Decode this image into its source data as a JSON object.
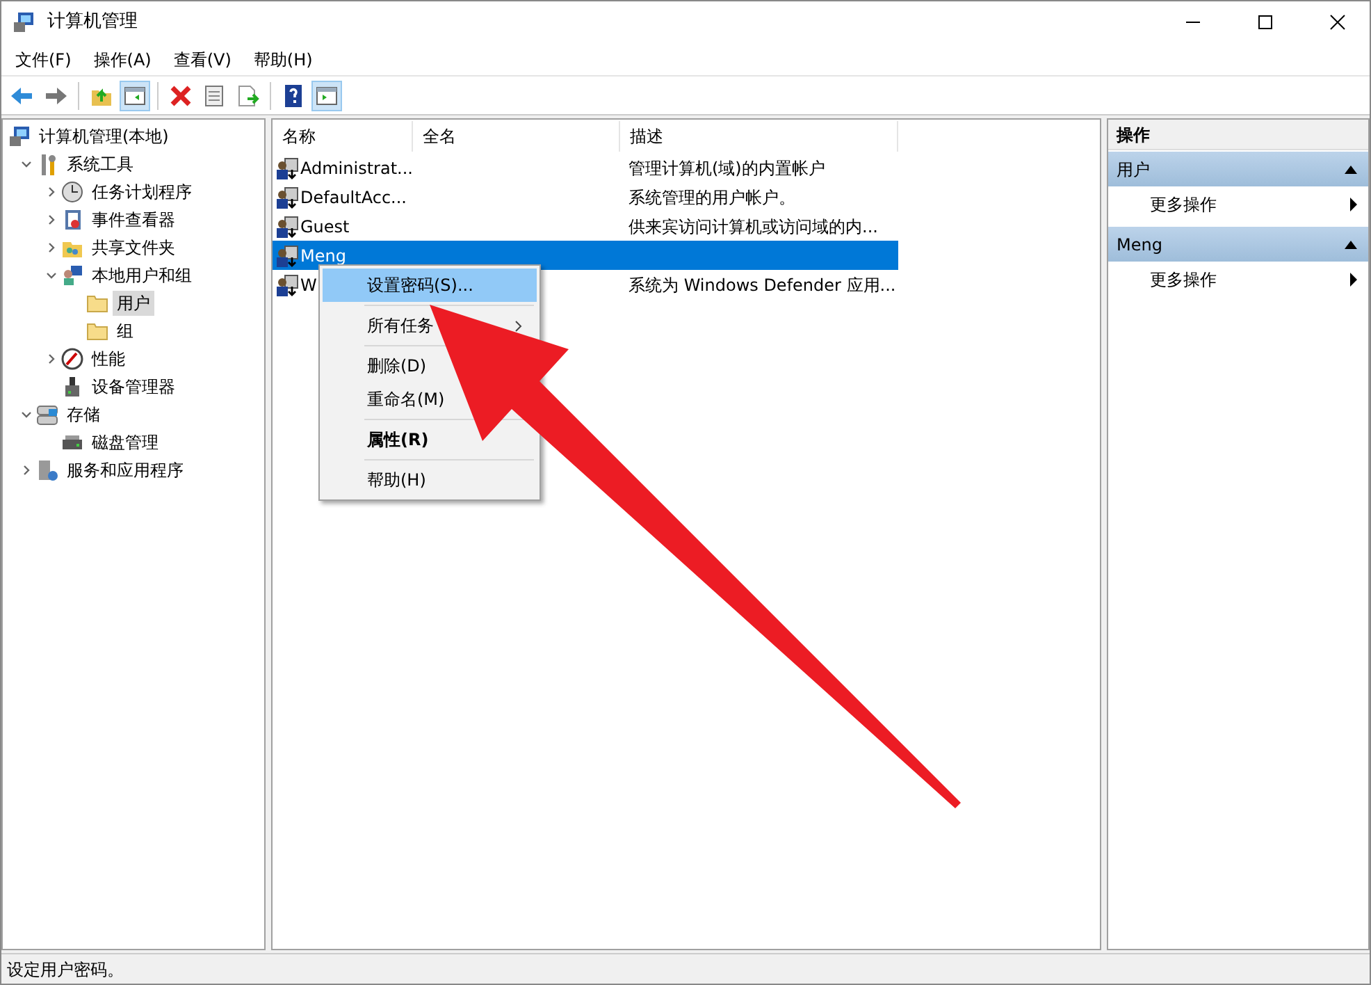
{
  "window": {
    "title": "计算机管理"
  },
  "menu": [
    "文件(F)",
    "操作(A)",
    "查看(V)",
    "帮助(H)"
  ],
  "toolbar": [
    {
      "kind": "back",
      "on": false
    },
    {
      "kind": "forward",
      "on": false
    },
    {
      "kind": "sep"
    },
    {
      "kind": "up",
      "on": false
    },
    {
      "kind": "tree",
      "on": true
    },
    {
      "kind": "sep"
    },
    {
      "kind": "delete",
      "on": false
    },
    {
      "kind": "props",
      "on": false
    },
    {
      "kind": "export",
      "on": false
    },
    {
      "kind": "sep"
    },
    {
      "kind": "help",
      "on": false
    },
    {
      "kind": "pane",
      "on": true
    }
  ],
  "tree": [
    {
      "label": "计算机管理(本地)",
      "kind": "computer",
      "selected": false,
      "children": [
        {
          "label": "系统工具",
          "kind": "tools",
          "selected": false,
          "expanded": true,
          "children": [
            {
              "label": "任务计划程序",
              "kind": "clock",
              "selected": false,
              "expanded": false
            },
            {
              "label": "事件查看器",
              "kind": "log",
              "selected": false,
              "expanded": false
            },
            {
              "label": "共享文件夹",
              "kind": "share",
              "selected": false,
              "expanded": false
            },
            {
              "label": "本地用户和组",
              "kind": "users",
              "selected": false,
              "expanded": true,
              "children": [
                {
                  "label": "用户",
                  "kind": "folder",
                  "selected": true
                },
                {
                  "label": "组",
                  "kind": "folder",
                  "selected": false
                }
              ]
            },
            {
              "label": "性能",
              "kind": "perf",
              "selected": false,
              "expanded": false
            },
            {
              "label": "设备管理器",
              "kind": "device",
              "selected": false
            }
          ]
        },
        {
          "label": "存储",
          "kind": "storage",
          "selected": false,
          "expanded": true,
          "children": [
            {
              "label": "磁盘管理",
              "kind": "disk",
              "selected": false
            }
          ]
        },
        {
          "label": "服务和应用程序",
          "kind": "services",
          "selected": false,
          "expanded": false
        }
      ]
    }
  ],
  "table": {
    "columns": [
      "名称",
      "全名",
      "描述"
    ],
    "rows": [
      {
        "name": "Administrat...",
        "description": "管理计算机(域)的内置帐户",
        "selected": false
      },
      {
        "name": "DefaultAcc...",
        "description": "系统管理的用户帐户。",
        "selected": false
      },
      {
        "name": "Guest",
        "description": "供来宾访问计算机或访问域的内...",
        "selected": false
      },
      {
        "name": "Meng",
        "selected": true
      },
      {
        "name": "W",
        "description": "系统为 Windows Defender 应用...",
        "selected": false
      }
    ]
  },
  "context_menu": [
    {
      "kind": "item",
      "label": "设置密码(S)...",
      "selected": true
    },
    {
      "kind": "separator"
    },
    {
      "kind": "item",
      "label": "所有任务",
      "selected": false,
      "submenu": true
    },
    {
      "kind": "separator"
    },
    {
      "kind": "item",
      "label": "删除(D)",
      "selected": false
    },
    {
      "kind": "item",
      "label": "重命名(M)",
      "selected": false
    },
    {
      "kind": "separator"
    },
    {
      "kind": "item",
      "label": "属性(R)",
      "selected": false,
      "bold": true
    },
    {
      "kind": "separator"
    },
    {
      "kind": "item",
      "label": "帮助(H)",
      "selected": false
    }
  ],
  "actions": {
    "title": "操作",
    "sections": [
      {
        "title": "用户",
        "expanded": true,
        "items": [
          "更多操作"
        ]
      },
      {
        "title": "Meng",
        "expanded": true,
        "items": [
          "更多操作"
        ]
      }
    ]
  },
  "status_bar": "设定用户密码。"
}
